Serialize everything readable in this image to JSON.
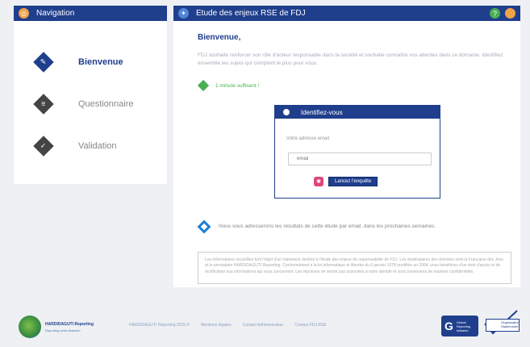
{
  "nav": {
    "title": "Navigation",
    "items": [
      {
        "label": "Bienvenue",
        "icon": "comment-icon"
      },
      {
        "label": "Questionnaire",
        "icon": "document-icon"
      },
      {
        "label": "Validation",
        "icon": "check-icon"
      }
    ]
  },
  "main": {
    "title": "Etude des enjeux RSE de FDJ",
    "welcome": "Bienvenue,",
    "intro": "FDJ souhaite renforcer son rôle d'acteur responsable dans la société et souhaite connaître vos attentes dans ce domaine. Identifiez ensemble les sujets qui comptent le plus pour vous.",
    "step1": "1 minute suffisent !",
    "identify": {
      "title": "Identifiez-vous",
      "email_label": "Votre adresse email",
      "email_placeholder": "email",
      "button": "Lancez l'enquête"
    },
    "step2": "Nous vous adresserons les résultats de cette étude par email, dans les prochaines semaines.",
    "disclaimer": "Les informations recueillies font l'objet d'un traitement destiné à l'étude des enjeux de responsabilité de FDJ. Les destinataires des données sont la Française des Jeux et le prestataire HARDIDAGUTI Reporting. Conformément à la loi informatique et libertés du 6 janvier 1978 modifiée en 2004, vous bénéficiez d'un droit d'accès et de rectification aux informations qui vous concernent. Les réponses ne seront pas associées à votre identité et sont conservées de manière confidentielle."
  },
  "footer": {
    "logo_name": "HARDIDAGUTI Reporting",
    "logo_sub": "Reporting extra-financier",
    "links": [
      "HARDIDAGUTI Reporting 2015 ©",
      "Mentions légales",
      "Contact Administrateur",
      "Contact FDJ RSE"
    ],
    "cert1_text": "Global Reporting Initiative",
    "cert2_text": "Organisation Stakeholder"
  },
  "colors": {
    "primary": "#1f3e8c",
    "accent_green": "#4aaf53",
    "accent_orange": "#f0a34a"
  }
}
